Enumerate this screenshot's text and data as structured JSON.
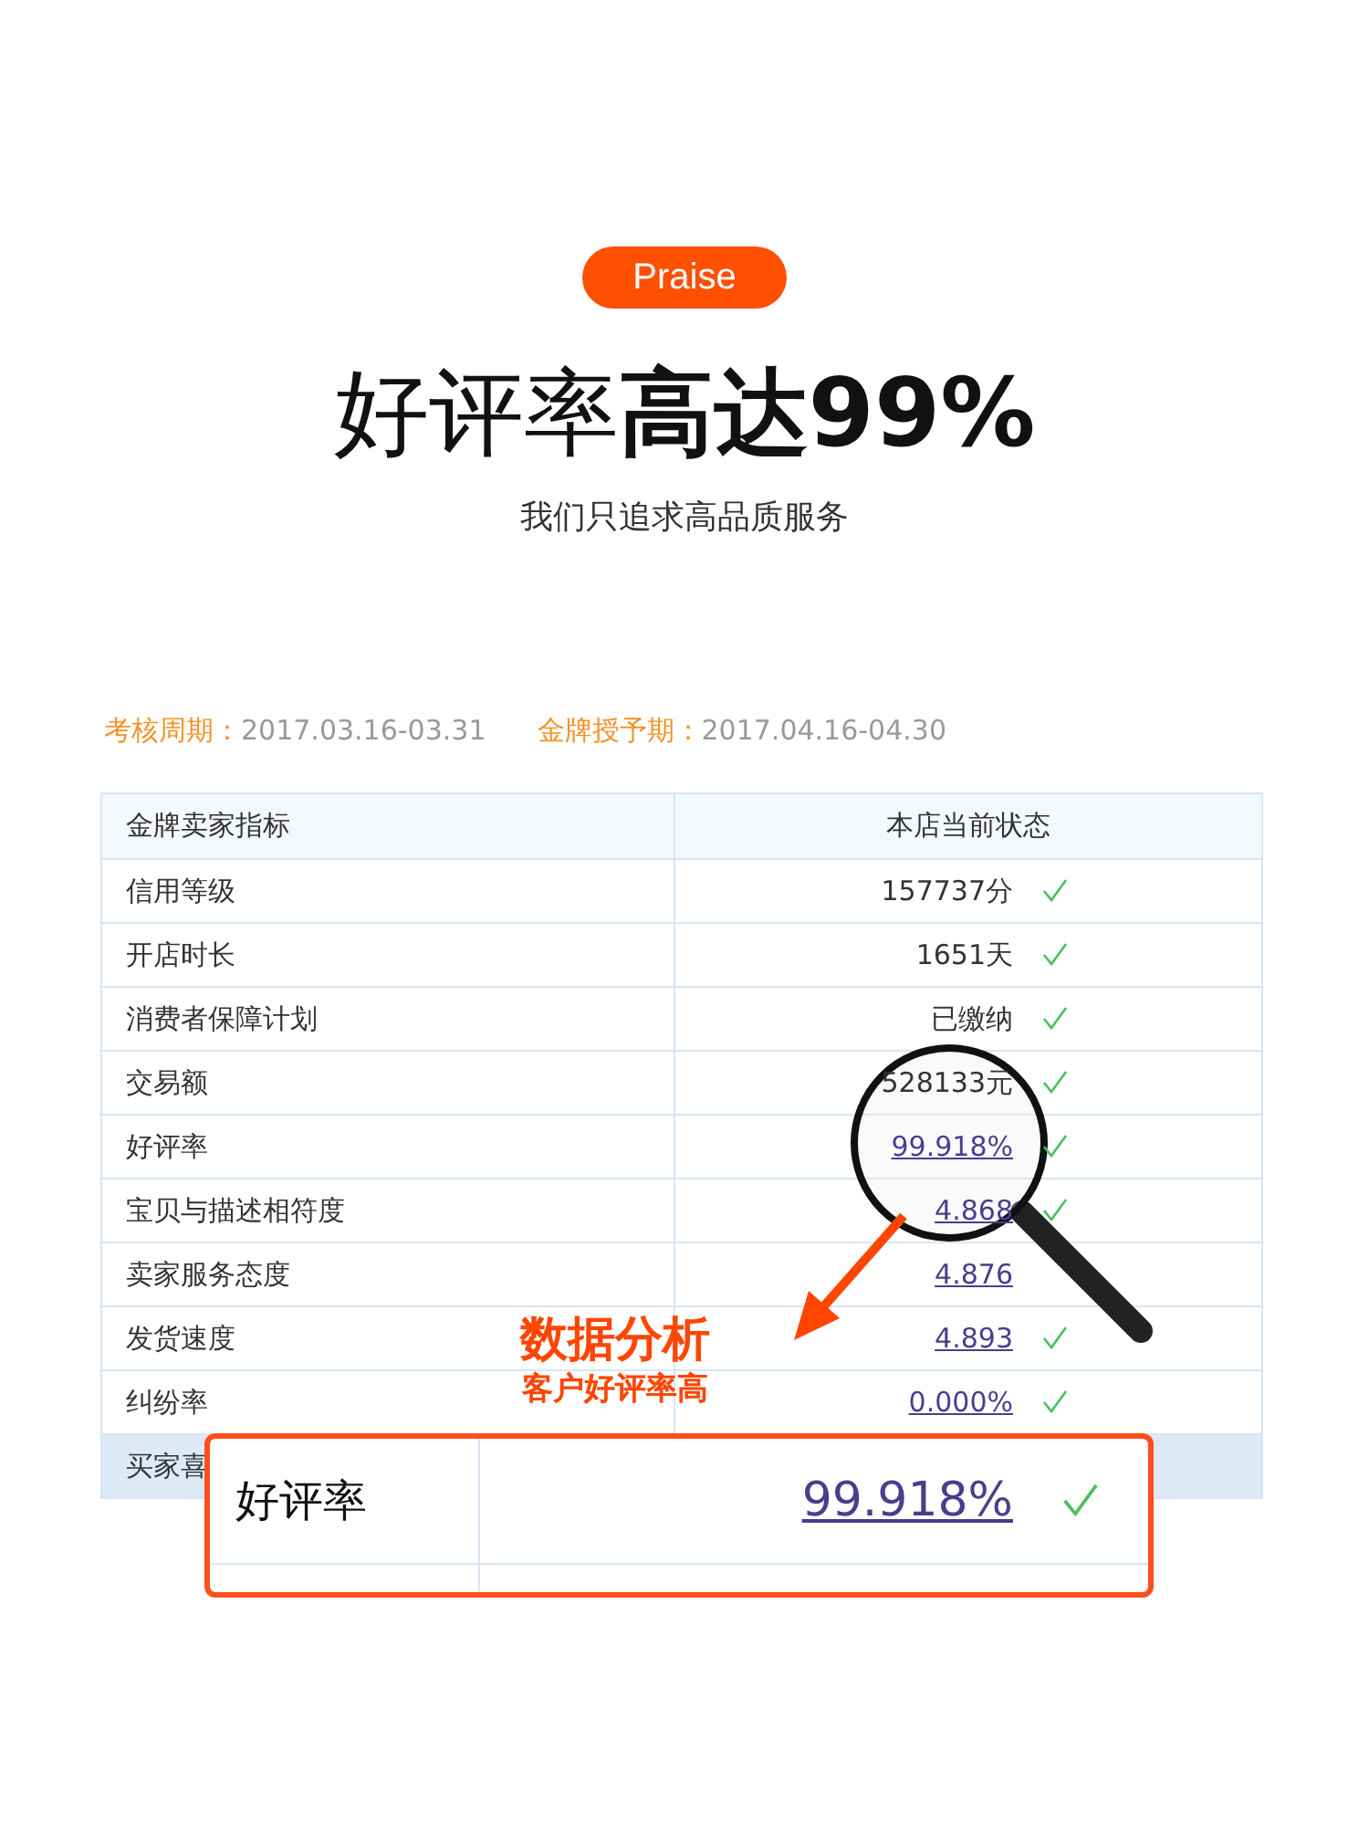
{
  "badge": "Praise",
  "headline": {
    "light": "好评率",
    "bold": "高达99%"
  },
  "subtitle": "我们只追求高品质服务",
  "periods": [
    {
      "label": "考核周期：",
      "value": "2017.03.16-03.31"
    },
    {
      "label": "金牌授予期：",
      "value": "2017.04.16-04.30"
    }
  ],
  "table": {
    "columns": [
      "金牌卖家指标",
      "本店当前状态"
    ],
    "rows": [
      {
        "label": "信用等级",
        "value": "157737分",
        "link": false,
        "checked": true
      },
      {
        "label": "开店时长",
        "value": "1651天",
        "link": false,
        "checked": true
      },
      {
        "label": "消费者保障计划",
        "value": "已缴纳",
        "link": false,
        "checked": true
      },
      {
        "label": "交易额",
        "value": "528133元",
        "link": false,
        "checked": true
      },
      {
        "label": "好评率",
        "value": "99.918%",
        "link": true,
        "checked": true
      },
      {
        "label": "宝贝与描述相符度",
        "value": "4.868",
        "link": true,
        "checked": true
      },
      {
        "label": "卖家服务态度",
        "value": "4.876",
        "link": true,
        "checked": false
      },
      {
        "label": "发货速度",
        "value": "4.893",
        "link": true,
        "checked": true
      },
      {
        "label": "纠纷率",
        "value": "0.000%",
        "link": true,
        "checked": true
      }
    ],
    "footer_row": {
      "label": "买家喜"
    }
  },
  "callout": {
    "title": "数据分析",
    "subtitle": "客户好评率高"
  },
  "zoom_box": {
    "label": "好评率",
    "value": "99.918%",
    "link": true,
    "checked": true
  }
}
